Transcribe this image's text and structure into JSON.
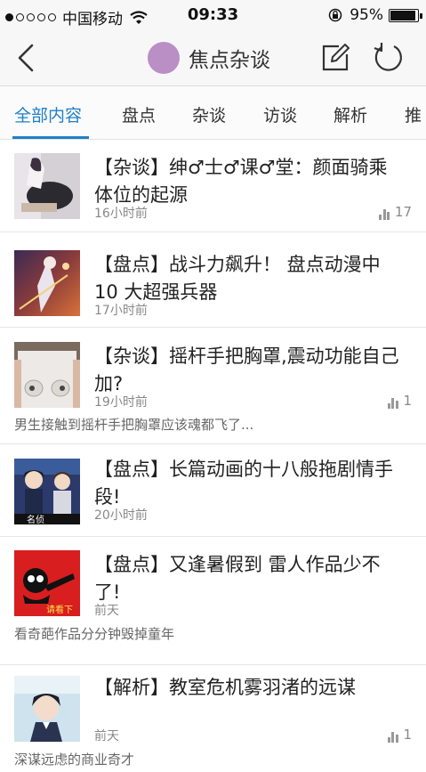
{
  "status_bar": {
    "carrier": "中国移动",
    "time": "09:33",
    "battery": "95%"
  },
  "nav": {
    "title": "焦点杂谈"
  },
  "tabs": [
    {
      "label": "全部内容",
      "active": true
    },
    {
      "label": "盘点"
    },
    {
      "label": "杂谈"
    },
    {
      "label": "访谈"
    },
    {
      "label": "解析"
    },
    {
      "label": "推"
    }
  ],
  "articles": [
    {
      "title": "【杂谈】绅♂士♂课♂堂：颜面骑乘体位的起源",
      "time": "16小时前",
      "count": "17",
      "summary": ""
    },
    {
      "title": "【盘点】战斗力飙升！ 盘点动漫中 10 大超强兵器",
      "time": "17小时前",
      "count": "",
      "summary": ""
    },
    {
      "title": "【杂谈】摇杆手把胸罩,震动功能自己加?",
      "time": "19小时前",
      "count": "1",
      "summary": "男生接触到摇杆手把胸罩应该魂都飞了..."
    },
    {
      "title": "【盘点】长篇动画的十八般拖剧情手段!",
      "time": "20小时前",
      "count": "",
      "summary": "",
      "thumb_text": "名侦"
    },
    {
      "title": "【盘点】又逢暑假到 雷人作品少不了!",
      "time": "前天",
      "count": "",
      "summary": "看奇葩作品分分钟毁掉童年",
      "thumb_text": "请看下"
    },
    {
      "title": "【解析】教室危机雾羽渚的远谋",
      "time": "前天",
      "count": "1",
      "summary": "深谋远虑的商业奇才"
    }
  ]
}
